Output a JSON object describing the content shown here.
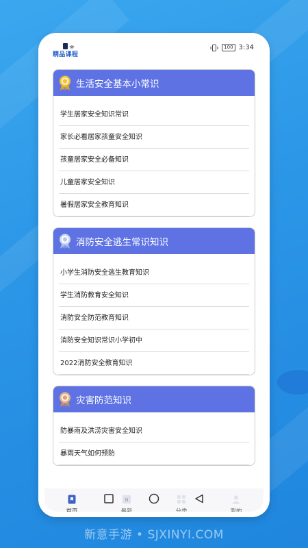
{
  "status": {
    "app_logo_text": "精品课程",
    "battery": "100",
    "time": "3:34"
  },
  "sections": [
    {
      "title": "生活安全基本小常识",
      "items": [
        "学生居家安全知识常识",
        "家长必看居家孩童安全知识",
        "孩童居家安全必备知识",
        "儿童居家安全知识",
        "暑假居家安全教育知识"
      ]
    },
    {
      "title": "消防安全逃生常识知识",
      "items": [
        "小学生消防安全逃生教育知识",
        "学生消防教育安全知识",
        "消防安全防范教育知识",
        "消防安全知识常识小学初中",
        "2022消防安全教育知识"
      ]
    },
    {
      "title": "灾害防范知识",
      "items": [
        "防暴雨及洪涝灾害安全知识",
        "暴雨天气如何预防"
      ]
    }
  ],
  "tabs": [
    {
      "label": "首页",
      "icon": "home-icon"
    },
    {
      "label": "最新",
      "icon": "new-icon"
    },
    {
      "label": "分类",
      "icon": "grid-icon"
    },
    {
      "label": "我的",
      "icon": "user-icon"
    }
  ],
  "watermark": "新意手游 • SJXINYI.COM",
  "colors": {
    "header": "#5e72e4",
    "background": "#2b95e6",
    "medal": "#f1c232"
  }
}
